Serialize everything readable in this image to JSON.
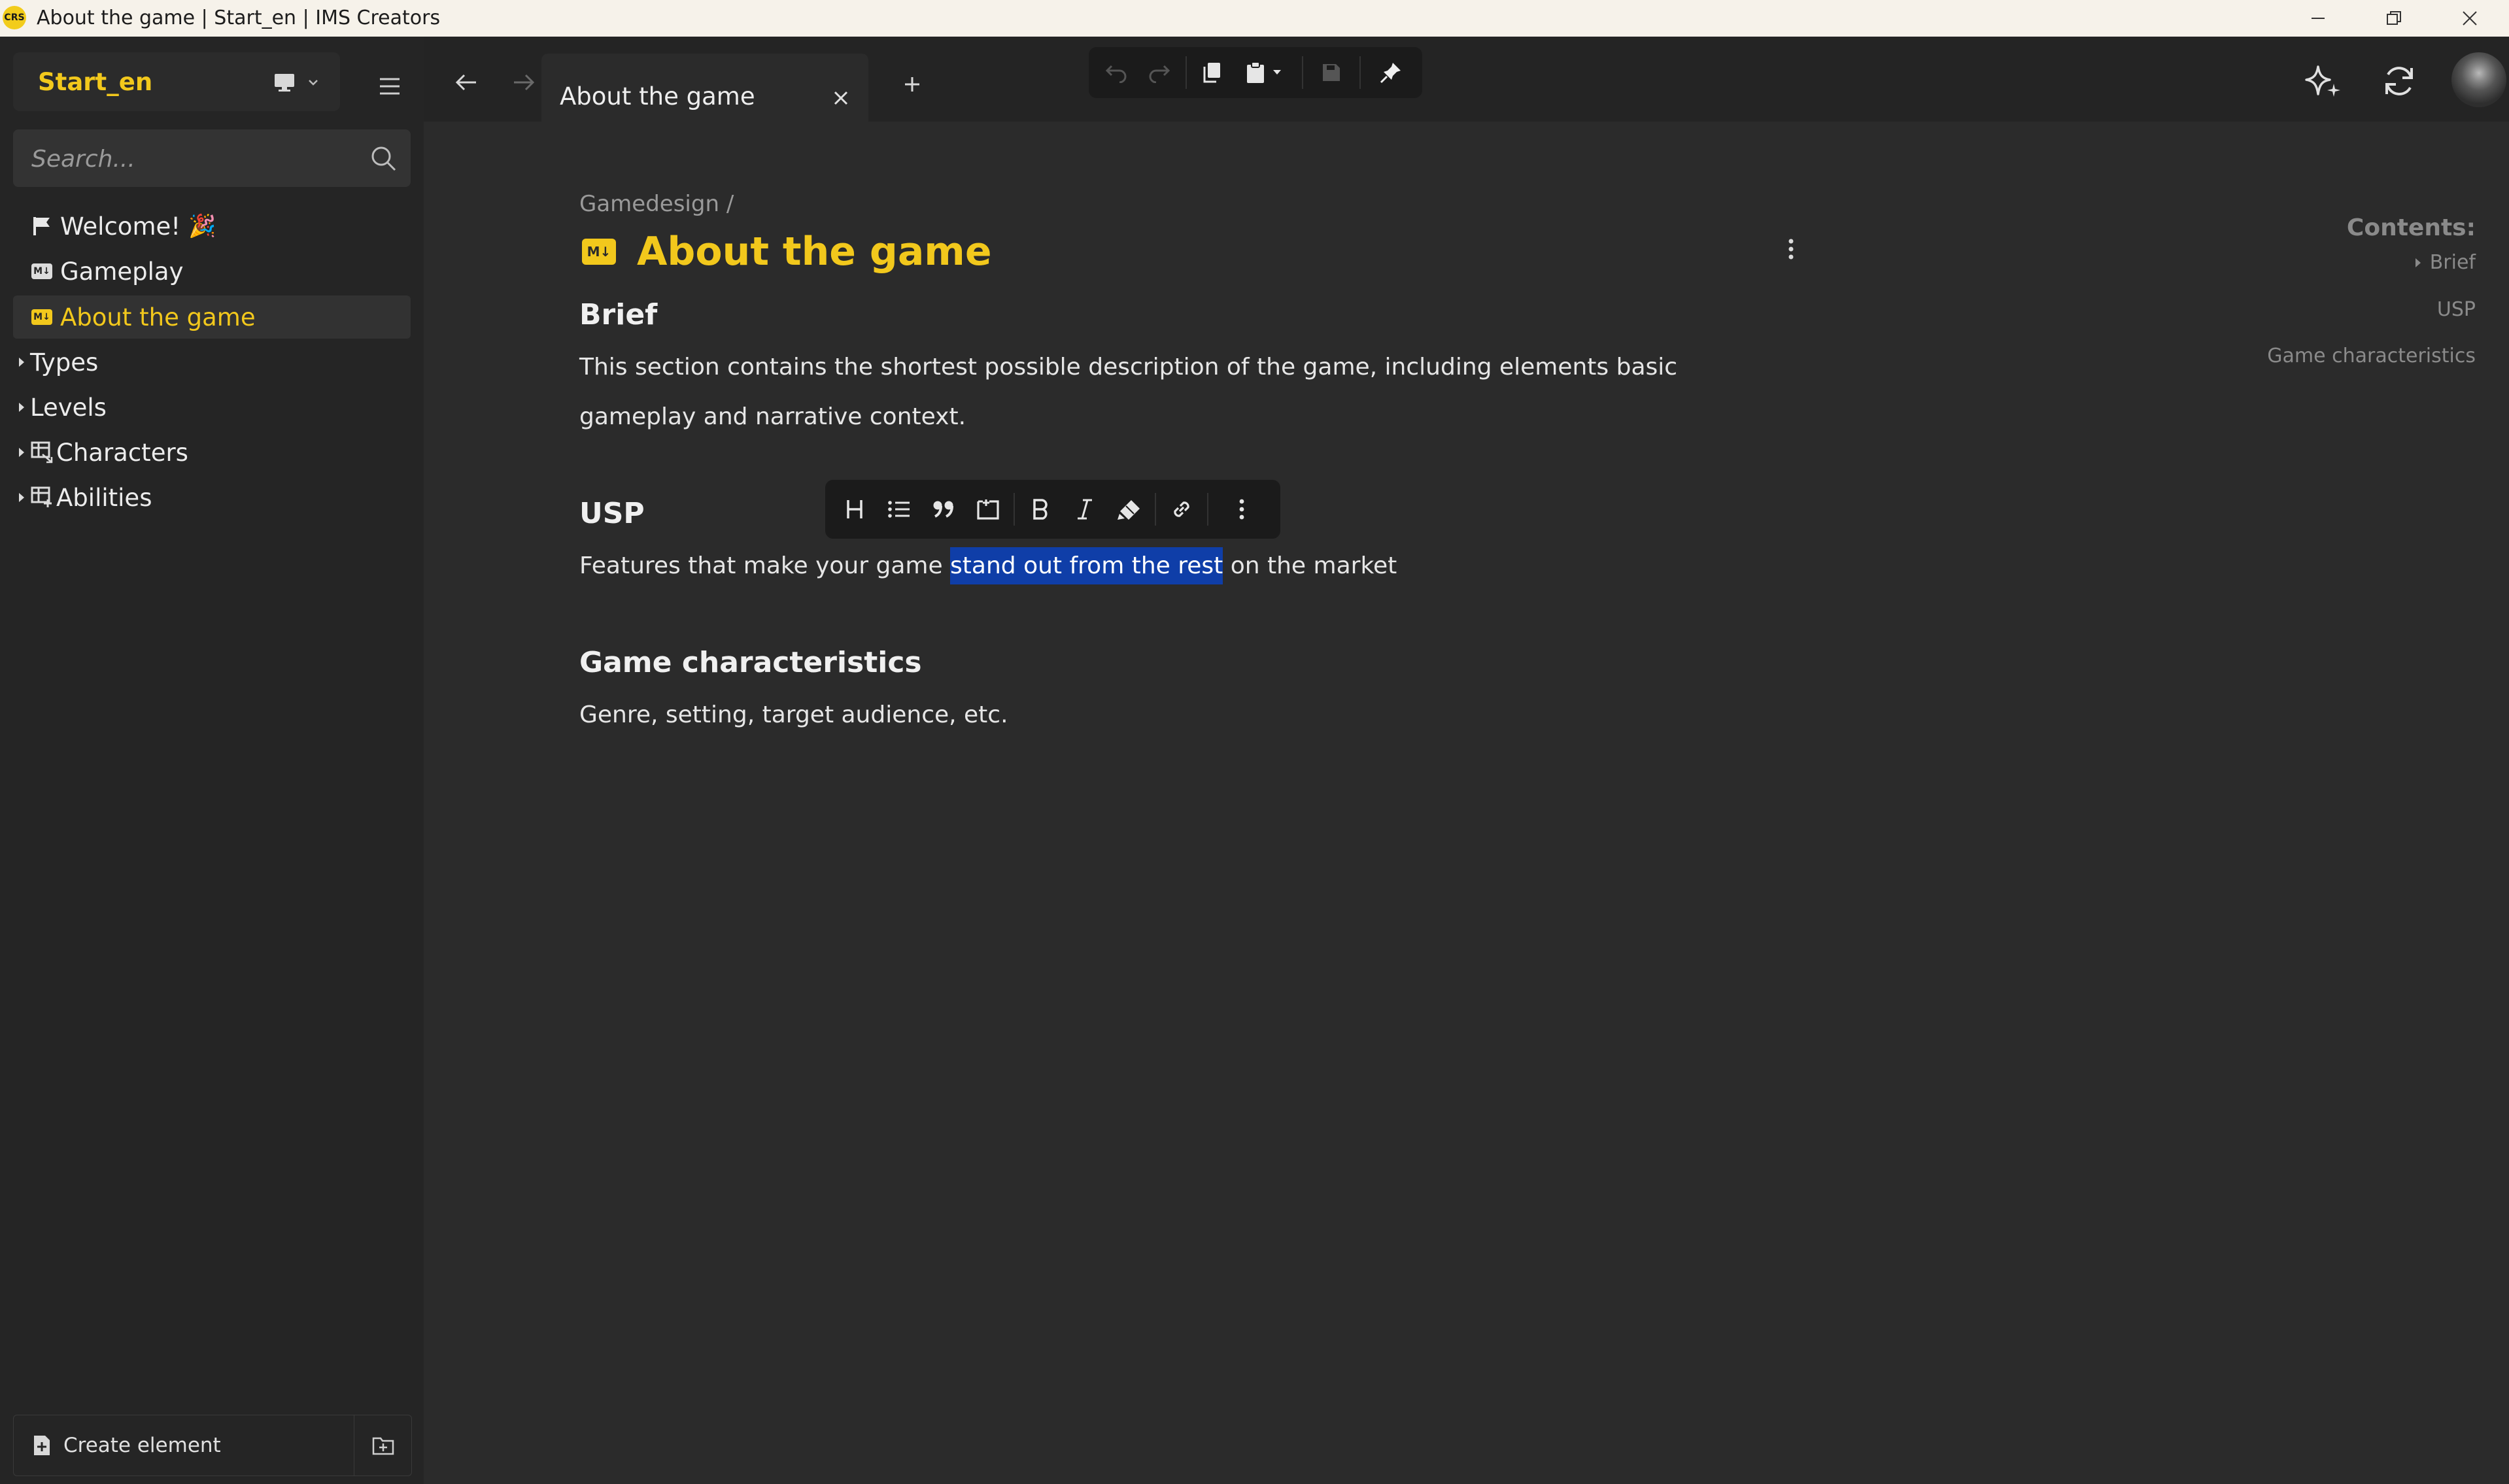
{
  "window": {
    "title": "About the game | Start_en | IMS Creators",
    "logo_text": "CRS"
  },
  "sidebar": {
    "workspace_name": "Start_en",
    "search_placeholder": "Search...",
    "items": [
      {
        "label": "Welcome!",
        "emoji": "🎉",
        "icon": "flag-icon"
      },
      {
        "label": "Gameplay",
        "icon": "markdown-icon"
      },
      {
        "label": "About the game",
        "icon": "markdown-icon",
        "active": true
      },
      {
        "label": "Types",
        "expandable": true
      },
      {
        "label": "Levels",
        "expandable": true
      },
      {
        "label": "Characters",
        "expandable": true,
        "icon": "table-icon"
      },
      {
        "label": "Abilities",
        "expandable": true,
        "icon": "table-icon"
      }
    ],
    "create_label": "Create element"
  },
  "tabs": [
    {
      "label": "About the game",
      "active": true
    }
  ],
  "document": {
    "breadcrumb": "Gamedesign /",
    "md_badge": "M↓",
    "title": "About the game",
    "sections": [
      {
        "heading": "Brief",
        "body": "This section contains the shortest possible description of the game, including elements basic gameplay and narrative context."
      },
      {
        "heading": "USP",
        "body_before": "Features that make your game ",
        "body_selected": "stand out from the rest",
        "body_after": " on the market"
      },
      {
        "heading": "Game characteristics",
        "body": "Genre, setting, target audience, etc."
      }
    ]
  },
  "format_toolbar": [
    "heading",
    "bullet-list",
    "quote",
    "block",
    "bold",
    "italic",
    "highlight",
    "link",
    "more"
  ],
  "toc": {
    "title": "Contents:",
    "items": [
      "Brief",
      "USP",
      "Game characteristics"
    ]
  },
  "colors": {
    "accent": "#f2c81c",
    "background": "#2b2b2b",
    "sidebar": "#252525",
    "selection": "#0f3ea8"
  }
}
